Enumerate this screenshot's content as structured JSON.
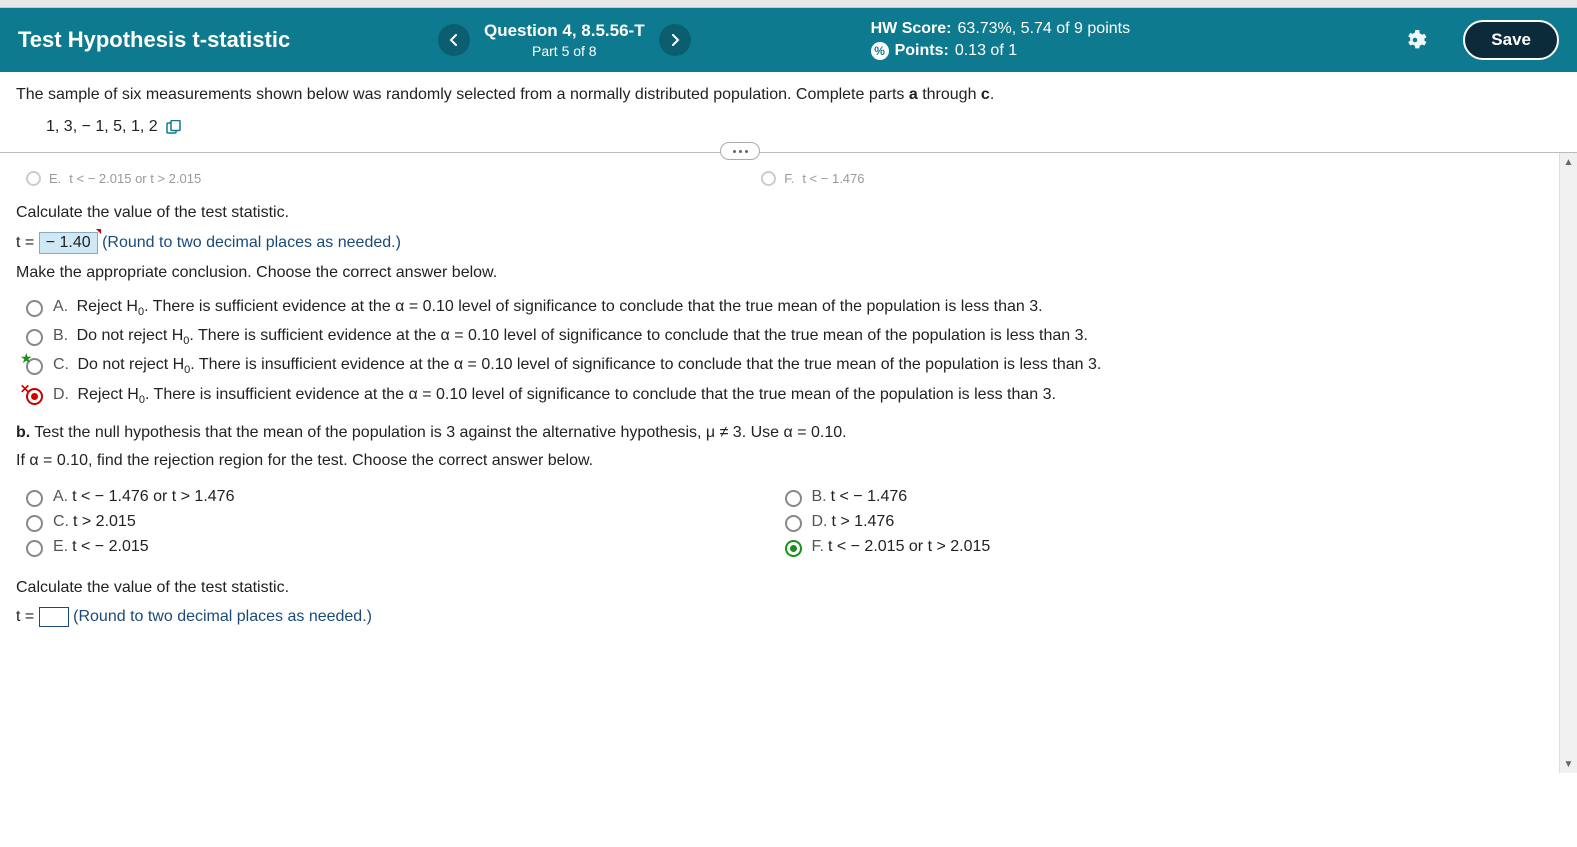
{
  "header": {
    "assignment_title": "Test Hypothesis t-statistic",
    "question_label": "Question 4, 8.5.56-T",
    "part_label": "Part 5 of 8",
    "hw_score_label": "HW Score:",
    "hw_score_value": "63.73%, 5.74 of 9 points",
    "points_label": "Points:",
    "points_value": "0.13 of 1",
    "save_label": "Save"
  },
  "problem": {
    "statement_before": "The sample of six measurements shown below was randomly selected from a normally distributed population. Complete parts ",
    "bold_a": "a",
    "mid": " through ",
    "bold_c": "c",
    "end": ".",
    "data": "1, 3, − 1, 5, 1, 2"
  },
  "cutoff": {
    "left_letter": "E.",
    "left_text": "t < − 2.015 or t > 2.015",
    "right_letter": "F.",
    "right_text": "t < − 1.476"
  },
  "calc1": {
    "prompt": "Calculate the value of the test statistic.",
    "t_label": "t =",
    "t_value": "− 1.40",
    "hint": "(Round to two decimal places as needed.)"
  },
  "conclude": {
    "prompt": "Make the appropriate conclusion. Choose the correct answer below.",
    "options": [
      {
        "letter": "A.",
        "text_before": "Reject H",
        "sub": "0",
        "text_after": ". There is sufficient evidence at the α = 0.10 level of significance to conclude that the true mean of the population is less than 3."
      },
      {
        "letter": "B.",
        "text_before": "Do not reject H",
        "sub": "0",
        "text_after": ". There is sufficient evidence at the α = 0.10 level of significance to conclude that the true mean of the population is less than 3."
      },
      {
        "letter": "C.",
        "text_before": "Do not reject H",
        "sub": "0",
        "text_after": ". There is insufficient evidence at the α = 0.10 level of significance to conclude that the true mean of the population is less than 3."
      },
      {
        "letter": "D.",
        "text_before": "Reject H",
        "sub": "0",
        "text_after": ". There is insufficient evidence at the α = 0.10 level of significance to conclude that the true mean of the population is less than 3."
      }
    ]
  },
  "partb": {
    "label": "b.",
    "text": "Test the null hypothesis that the mean of the population is 3 against the alternative hypothesis, μ ≠ 3. Use α = 0.10.",
    "rr_prompt": "If α = 0.10, find the rejection region for the test. Choose the correct answer below.",
    "options_left": [
      {
        "letter": "A.",
        "text": "t < − 1.476 or t > 1.476"
      },
      {
        "letter": "C.",
        "text": "t > 2.015"
      },
      {
        "letter": "E.",
        "text": "t < − 2.015"
      }
    ],
    "options_right": [
      {
        "letter": "B.",
        "text": "t < − 1.476"
      },
      {
        "letter": "D.",
        "text": "t > 1.476"
      },
      {
        "letter": "F.",
        "text": "t < − 2.015 or t > 2.015"
      }
    ]
  },
  "calc2": {
    "prompt": "Calculate the value of the test statistic.",
    "t_label": "t =",
    "hint": "(Round to two decimal places as needed.)"
  }
}
